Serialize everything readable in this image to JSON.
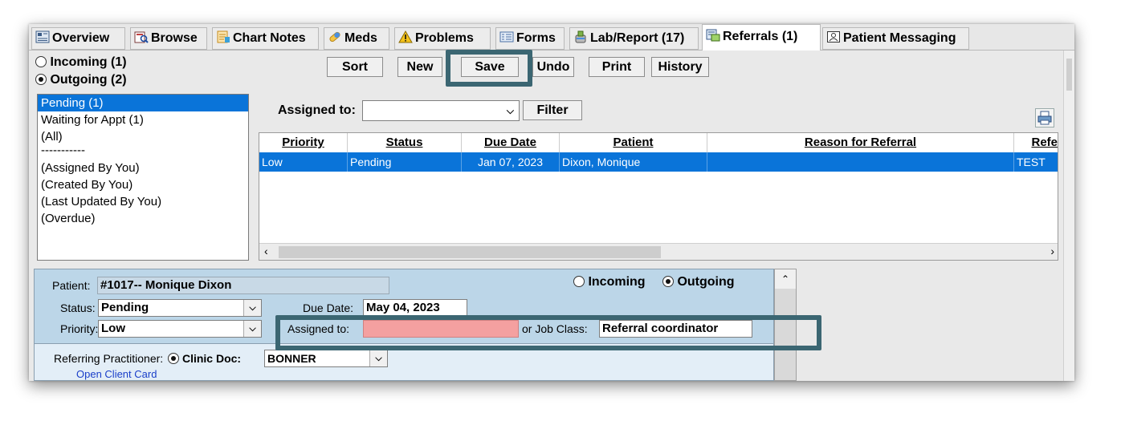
{
  "tabs": [
    {
      "label": "Overview",
      "icon": "overview-icon"
    },
    {
      "label": "Browse",
      "icon": "browse-icon"
    },
    {
      "label": "Chart Notes",
      "icon": "chart-notes-icon"
    },
    {
      "label": "Meds",
      "icon": "pill-icon"
    },
    {
      "label": "Problems",
      "icon": "warning-icon"
    },
    {
      "label": "Forms",
      "icon": "forms-icon"
    },
    {
      "label": "Lab/Report (17)",
      "icon": "lab-icon"
    },
    {
      "label": "Referrals (1)",
      "icon": "referrals-icon"
    },
    {
      "label": "Patient Messaging",
      "icon": "messaging-icon"
    }
  ],
  "direction": {
    "incoming": "Incoming (1)",
    "outgoing": "Outgoing (2)"
  },
  "toolbar": {
    "sort": "Sort",
    "new": "New",
    "save": "Save",
    "undo": "Undo",
    "print": "Print",
    "history": "History"
  },
  "filters": [
    "Pending (1)",
    "Waiting for Appt (1)",
    "(All)",
    "-----------",
    "(Assigned By You)",
    "(Created By You)",
    "(Last Updated By You)",
    "(Overdue)"
  ],
  "assigned": {
    "label": "Assigned to:",
    "value": "",
    "filter_button": "Filter"
  },
  "table": {
    "columns": [
      "Priority",
      "Status",
      "Due Date",
      "Patient",
      "Reason for Referral",
      "Refe"
    ],
    "rows": [
      [
        "Low",
        "Pending",
        "Jan 07, 2023",
        "Dixon, Monique",
        "",
        "TEST"
      ]
    ]
  },
  "detail": {
    "patient_label": "Patient:",
    "patient_value": "#1017-- Monique Dixon",
    "incoming_label": "Incoming",
    "outgoing_label": "Outgoing",
    "status_label": "Status:",
    "status_value": "Pending",
    "due_date_label": "Due Date:",
    "due_date_value": "May 04, 2023",
    "priority_label": "Priority:",
    "priority_value": "Low",
    "assigned_label": "Assigned to:",
    "assigned_value": "",
    "job_class_label": "or Job Class:",
    "job_class_value": "Referral coordinator",
    "referring_label": "Referring Practitioner:",
    "clinic_doc_label": "Clinic Doc:",
    "clinic_doc_value": "BONNER",
    "open_client_card": "Open Client Card"
  },
  "colors": {
    "highlight_border": "#3b6672",
    "selection": "#0a74d9",
    "detail_bg": "#bcd6e8",
    "assigned_error": "#f4a0a0"
  }
}
